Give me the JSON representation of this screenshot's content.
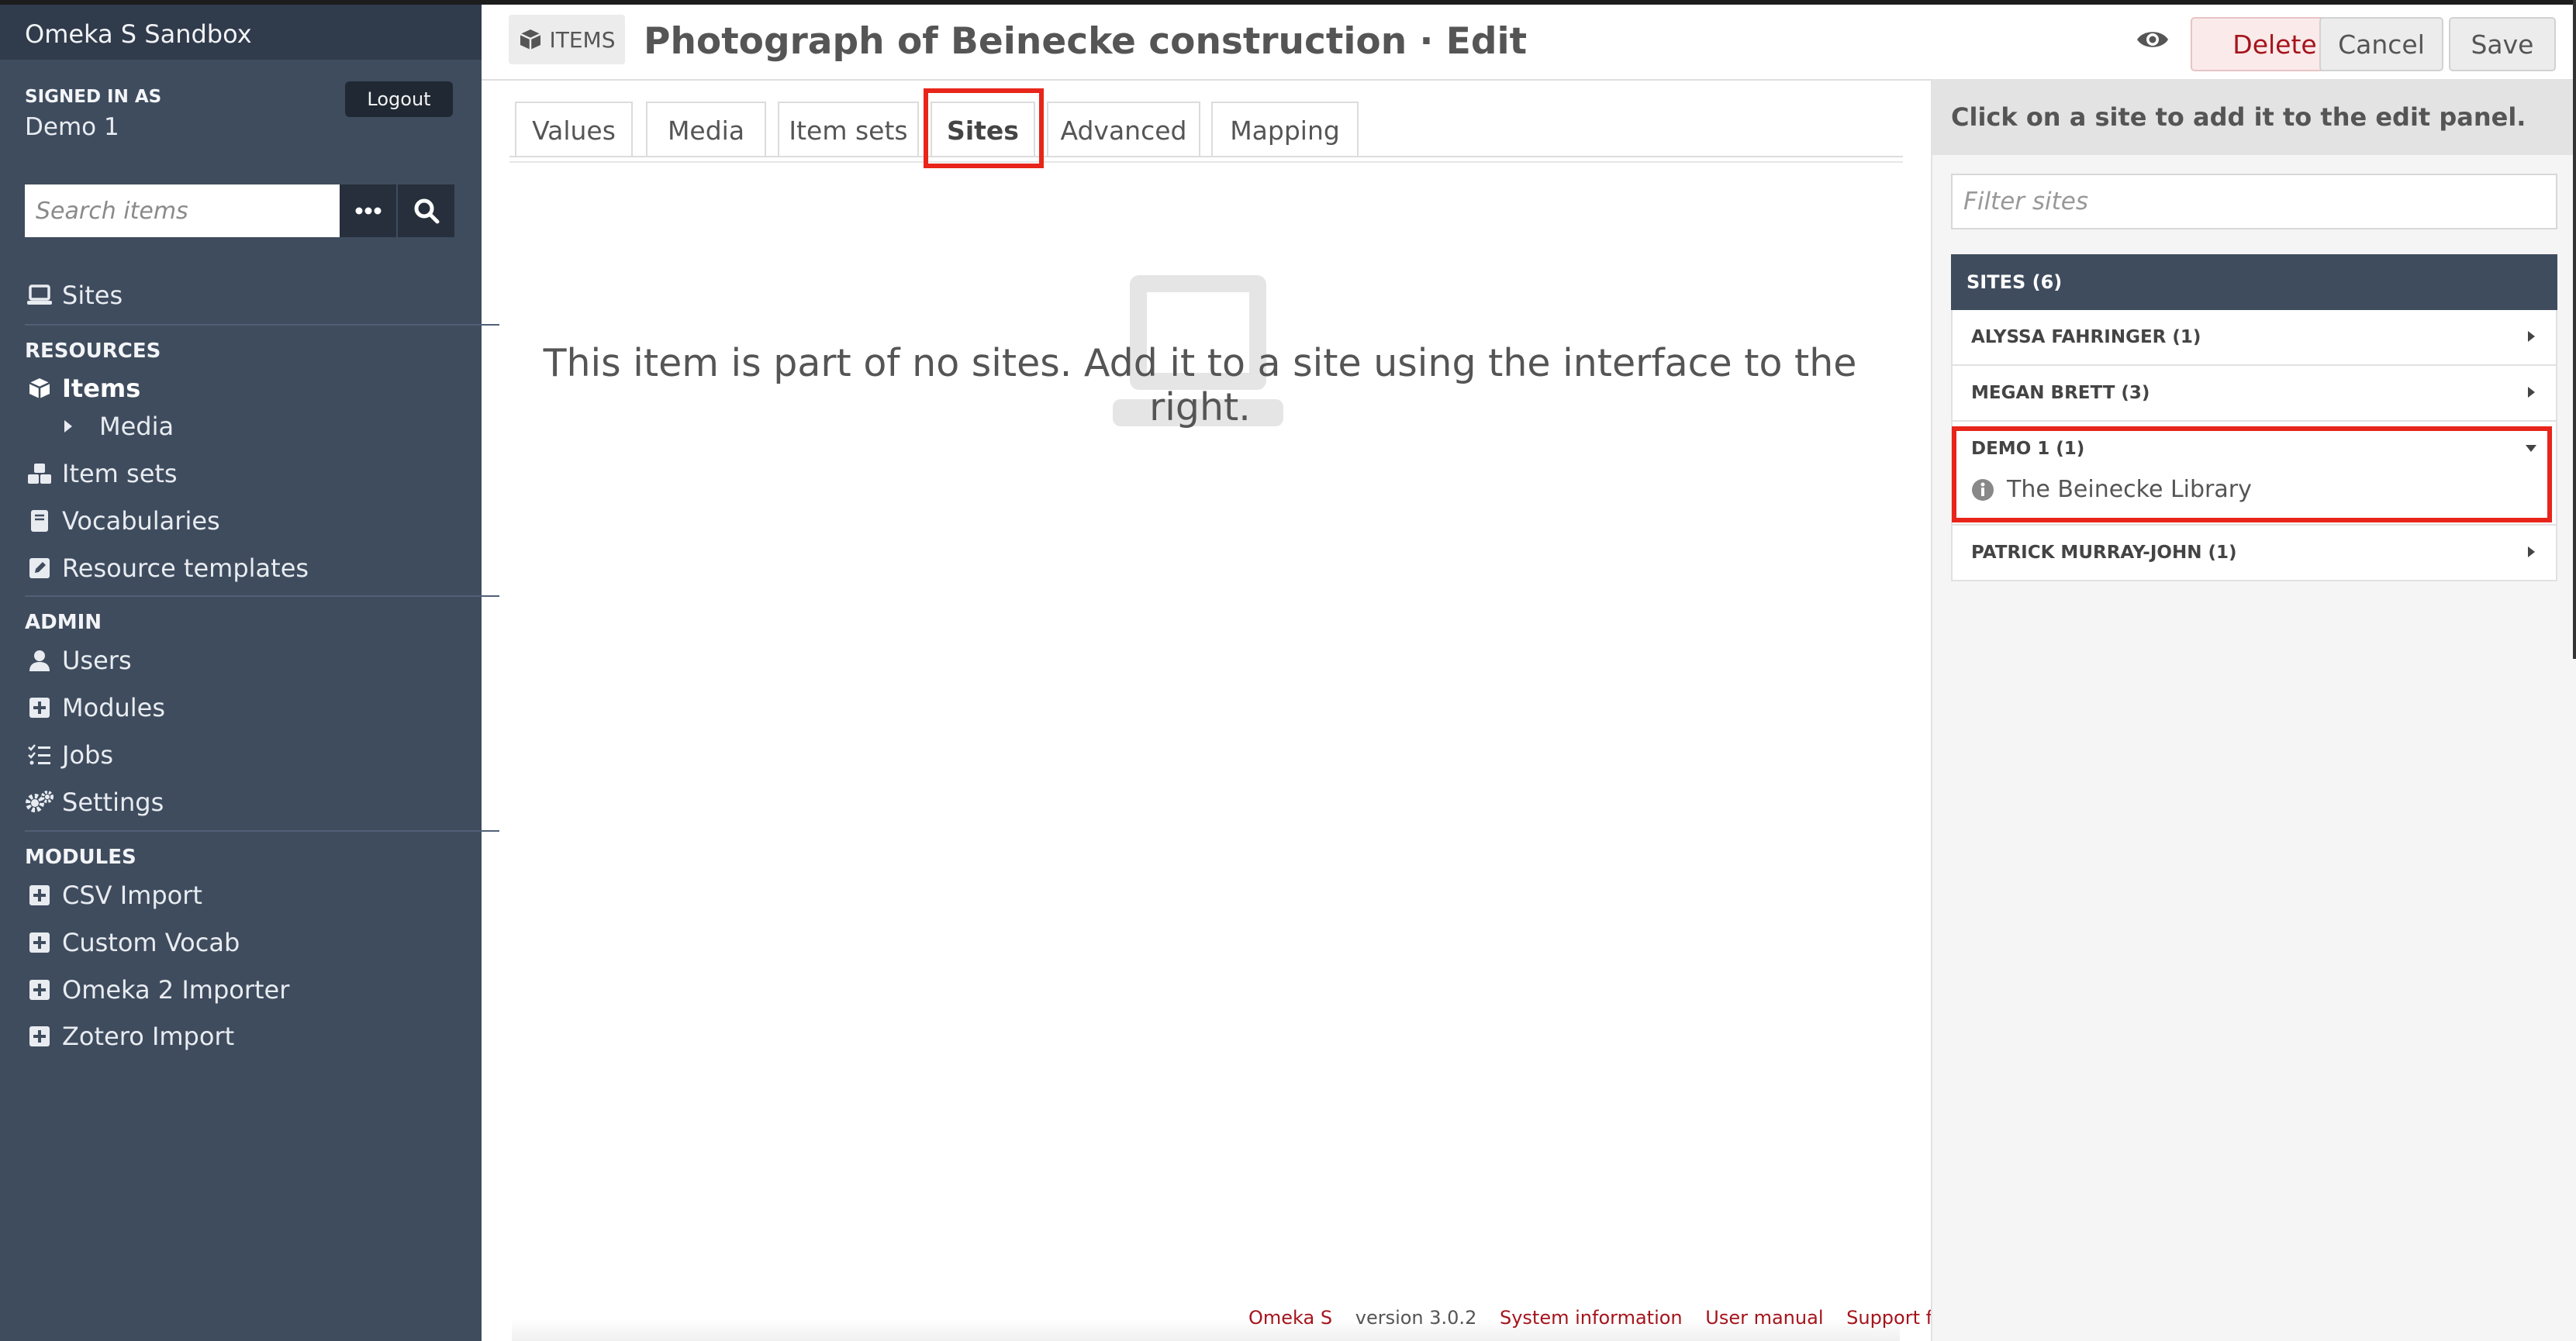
{
  "sidebar": {
    "brand": "Omeka S Sandbox",
    "signed_in_label": "SIGNED IN AS",
    "user_name": "Demo 1",
    "logout_label": "Logout",
    "search_placeholder": "Search items",
    "nav": {
      "sites": "Sites",
      "resources_heading": "RESOURCES",
      "items": "Items",
      "media": "Media",
      "item_sets": "Item sets",
      "vocabularies": "Vocabularies",
      "resource_templates": "Resource templates",
      "admin_heading": "ADMIN",
      "users": "Users",
      "modules": "Modules",
      "jobs": "Jobs",
      "settings": "Settings",
      "modules_heading": "MODULES",
      "csv_import": "CSV Import",
      "custom_vocab": "Custom Vocab",
      "omeka2_importer": "Omeka 2 Importer",
      "zotero_import": "Zotero Import"
    }
  },
  "header": {
    "crumb_label": "ITEMS",
    "title": "Photograph of Beinecke construction  ·  Edit",
    "delete_label": "Delete",
    "cancel_label": "Cancel",
    "save_label": "Save"
  },
  "tabs": {
    "values": "Values",
    "media": "Media",
    "item_sets": "Item sets",
    "sites": "Sites",
    "advanced": "Advanced",
    "mapping": "Mapping"
  },
  "main": {
    "empty_message": "This item is part of no sites. Add it to a site using the interface to the right."
  },
  "footer": {
    "omeka_s": "Omeka S",
    "version": "version 3.0.2",
    "system_information": "System information",
    "user_manual": "User manual",
    "support_forums": "Support forums"
  },
  "right_panel": {
    "hint": "Click on a site to add it to the edit panel.",
    "filter_placeholder": "Filter sites",
    "sites_heading": "SITES (6)",
    "groups": [
      {
        "label": "ALYSSA FAHRINGER (1)"
      },
      {
        "label": "MEGAN BRETT (3)"
      },
      {
        "label": "DEMO 1 (1)",
        "child": "The Beinecke Library"
      },
      {
        "label": "PATRICK MURRAY-JOHN (1)"
      }
    ]
  },
  "colors": {
    "sidebar_bg": "#3f4c5e",
    "sidebar_brand_bg": "#303b4b",
    "danger": "#a5141c",
    "highlight": "#e8251a"
  }
}
